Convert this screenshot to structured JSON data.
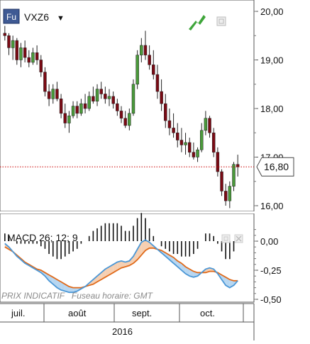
{
  "header": {
    "badge": "Fu",
    "symbol": "VXZ6",
    "dropdown_glyph": "▼"
  },
  "colors": {
    "up": "#4a9a3a",
    "down": "#7a0a14",
    "wick": "#222222",
    "macd_line": "#4b97d6",
    "signal_line": "#e06a1a",
    "macd_fill": "#a9cfee",
    "signal_fill": "#f5c7a3",
    "histogram": "#111111",
    "last_price_line": "#cc0000",
    "badge_bg": "#3f5a94",
    "panel_border": "#555555"
  },
  "chart_data": [
    {
      "type": "candlestick",
      "panel": "price",
      "title": "VXZ6",
      "ylim": [
        15.8,
        20.35
      ],
      "y_ticks": [
        "16,00",
        "17,00",
        "18,00",
        "19,00",
        "20,00"
      ],
      "last_price": 16.8,
      "last_price_label": "16,80",
      "ohlc": [
        [
          19.55,
          19.7,
          19.4,
          19.5
        ],
        [
          19.5,
          19.55,
          19.1,
          19.25
        ],
        [
          19.25,
          19.5,
          19.0,
          19.4
        ],
        [
          19.4,
          19.45,
          18.9,
          19.0
        ],
        [
          19.0,
          19.35,
          18.85,
          19.25
        ],
        [
          19.25,
          19.4,
          18.95,
          19.05
        ],
        [
          19.05,
          19.2,
          18.85,
          18.95
        ],
        [
          18.95,
          19.25,
          18.9,
          19.15
        ],
        [
          19.15,
          19.3,
          18.9,
          19.0
        ],
        [
          19.0,
          19.1,
          18.65,
          18.75
        ],
        [
          18.75,
          18.85,
          18.25,
          18.35
        ],
        [
          18.35,
          18.5,
          18.05,
          18.2
        ],
        [
          18.2,
          18.5,
          18.1,
          18.4
        ],
        [
          18.4,
          18.55,
          18.15,
          18.2
        ],
        [
          18.2,
          18.3,
          17.8,
          17.9
        ],
        [
          17.9,
          18.1,
          17.6,
          17.7
        ],
        [
          17.7,
          17.95,
          17.5,
          17.85
        ],
        [
          17.85,
          18.15,
          17.8,
          18.05
        ],
        [
          18.05,
          18.15,
          17.8,
          17.9
        ],
        [
          17.9,
          18.2,
          17.85,
          18.1
        ],
        [
          18.1,
          18.3,
          17.9,
          18.0
        ],
        [
          18.0,
          18.35,
          17.95,
          18.25
        ],
        [
          18.25,
          18.45,
          18.1,
          18.15
        ],
        [
          18.15,
          18.5,
          18.05,
          18.4
        ],
        [
          18.4,
          18.55,
          18.2,
          18.3
        ],
        [
          18.3,
          18.45,
          18.1,
          18.2
        ],
        [
          18.2,
          18.4,
          18.05,
          18.25
        ],
        [
          18.25,
          18.35,
          18.0,
          18.1
        ],
        [
          18.1,
          18.2,
          17.85,
          17.95
        ],
        [
          17.95,
          18.05,
          17.7,
          17.8
        ],
        [
          17.8,
          17.95,
          17.6,
          17.65
        ],
        [
          17.65,
          18.0,
          17.55,
          17.9
        ],
        [
          17.9,
          18.6,
          17.85,
          18.5
        ],
        [
          18.5,
          19.2,
          18.4,
          19.1
        ],
        [
          19.1,
          19.45,
          18.95,
          19.3
        ],
        [
          19.3,
          19.6,
          19.0,
          19.1
        ],
        [
          19.1,
          19.3,
          18.8,
          18.9
        ],
        [
          18.9,
          19.2,
          18.6,
          18.7
        ],
        [
          18.7,
          18.9,
          18.2,
          18.35
        ],
        [
          18.35,
          18.6,
          17.95,
          18.1
        ],
        [
          18.1,
          18.3,
          17.6,
          17.75
        ],
        [
          17.75,
          18.0,
          17.45,
          17.6
        ],
        [
          17.6,
          17.9,
          17.4,
          17.5
        ],
        [
          17.5,
          17.7,
          17.2,
          17.35
        ],
        [
          17.35,
          17.6,
          17.1,
          17.25
        ],
        [
          17.25,
          17.5,
          17.05,
          17.3
        ],
        [
          17.3,
          17.4,
          17.0,
          17.1
        ],
        [
          17.1,
          17.3,
          16.95,
          17.0
        ],
        [
          17.0,
          17.2,
          16.9,
          17.15
        ],
        [
          17.15,
          17.7,
          17.1,
          17.55
        ],
        [
          17.55,
          17.95,
          17.45,
          17.8
        ],
        [
          17.8,
          17.85,
          17.4,
          17.5
        ],
        [
          17.5,
          17.6,
          17.0,
          17.1
        ],
        [
          17.1,
          17.2,
          16.6,
          16.7
        ],
        [
          16.7,
          16.75,
          16.2,
          16.3
        ],
        [
          16.3,
          16.45,
          16.0,
          16.1
        ],
        [
          16.1,
          16.5,
          15.95,
          16.4
        ],
        [
          16.4,
          16.9,
          16.3,
          16.85
        ],
        [
          16.85,
          17.05,
          16.6,
          16.8
        ]
      ],
      "x_month_labels": [
        "juil.",
        "août",
        "sept.",
        "oct."
      ],
      "x_year_label": "2016"
    },
    {
      "type": "line",
      "panel": "indicator",
      "title": "MACD 26; 12; 9",
      "ylim": [
        -0.6,
        0.15
      ],
      "y_ticks": [
        "0,00",
        "-0,25",
        "-0,50"
      ],
      "series": [
        {
          "name": "MACD",
          "values": [
            -0.02,
            -0.05,
            -0.09,
            -0.13,
            -0.16,
            -0.19,
            -0.21,
            -0.23,
            -0.25,
            -0.27,
            -0.3,
            -0.34,
            -0.37,
            -0.4,
            -0.42,
            -0.43,
            -0.44,
            -0.44,
            -0.43,
            -0.41,
            -0.39,
            -0.36,
            -0.33,
            -0.3,
            -0.27,
            -0.24,
            -0.22,
            -0.2,
            -0.18,
            -0.17,
            -0.18,
            -0.17,
            -0.13,
            -0.07,
            -0.01,
            0.01,
            -0.01,
            -0.04,
            -0.07,
            -0.1,
            -0.13,
            -0.16,
            -0.19,
            -0.22,
            -0.25,
            -0.28,
            -0.3,
            -0.31,
            -0.3,
            -0.27,
            -0.24,
            -0.23,
            -0.24,
            -0.28,
            -0.33,
            -0.38,
            -0.4,
            -0.38,
            -0.34
          ]
        },
        {
          "name": "Signal",
          "values": [
            -0.05,
            -0.07,
            -0.09,
            -0.12,
            -0.15,
            -0.18,
            -0.2,
            -0.22,
            -0.24,
            -0.25,
            -0.27,
            -0.29,
            -0.31,
            -0.33,
            -0.35,
            -0.37,
            -0.39,
            -0.4,
            -0.4,
            -0.4,
            -0.39,
            -0.38,
            -0.37,
            -0.35,
            -0.33,
            -0.31,
            -0.29,
            -0.27,
            -0.25,
            -0.23,
            -0.22,
            -0.21,
            -0.19,
            -0.16,
            -0.12,
            -0.08,
            -0.06,
            -0.06,
            -0.07,
            -0.08,
            -0.1,
            -0.12,
            -0.14,
            -0.17,
            -0.19,
            -0.22,
            -0.24,
            -0.26,
            -0.27,
            -0.27,
            -0.27,
            -0.26,
            -0.26,
            -0.27,
            -0.29,
            -0.31,
            -0.33,
            -0.34,
            -0.34
          ]
        },
        {
          "name": "Histogram",
          "values": [
            0.03,
            0.02,
            0.0,
            -0.01,
            -0.01,
            -0.01,
            -0.01,
            -0.01,
            -0.01,
            -0.02,
            -0.03,
            -0.05,
            -0.06,
            -0.07,
            -0.07,
            -0.06,
            -0.05,
            -0.04,
            -0.03,
            -0.01,
            0.0,
            0.02,
            0.04,
            0.05,
            0.06,
            0.07,
            0.07,
            0.07,
            0.07,
            0.06,
            0.04,
            0.04,
            0.06,
            0.09,
            0.11,
            0.09,
            0.05,
            0.02,
            0.0,
            -0.02,
            -0.03,
            -0.04,
            -0.05,
            -0.05,
            -0.06,
            -0.06,
            -0.06,
            -0.05,
            -0.03,
            0.0,
            0.03,
            0.03,
            0.02,
            -0.01,
            -0.04,
            -0.07,
            -0.07,
            -0.04,
            0.0
          ]
        }
      ]
    }
  ],
  "footer_watermark": "PRIX INDICATIF   Fuseau horaire: GMT"
}
